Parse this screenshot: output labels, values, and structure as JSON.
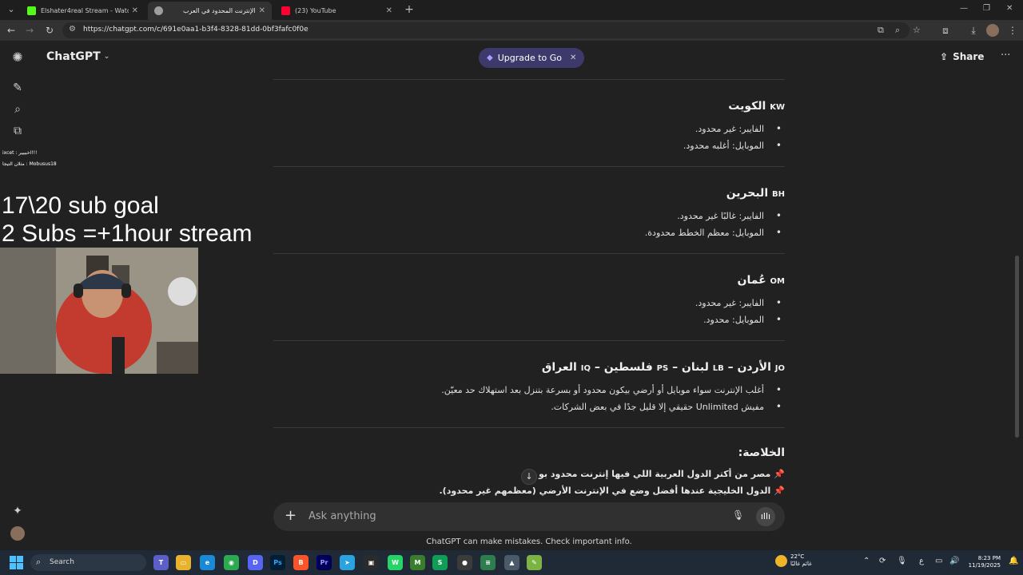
{
  "browser": {
    "tabs": [
      {
        "title": "Elshater4real Stream - Watch Li",
        "favicon_color": "#53fc18",
        "active": false
      },
      {
        "title": "الإنترنت المحدود في العرب",
        "favicon_color": "#9e9e9e",
        "active": true
      },
      {
        "title": "(23) YouTube",
        "favicon_color": "#ff0033",
        "active": false
      }
    ],
    "new_tab_icon": "plus-icon",
    "url": "https://chatgpt.com/c/691e0aa1-b3f4-8328-81dd-0bf3fafc0f0e"
  },
  "app": {
    "model_name": "ChatGPT",
    "upgrade_label": "Upgrade to Go",
    "share_label": "Share",
    "accent_color": "#3d3a6b"
  },
  "overlay": {
    "chat_line_1": "ixcet : اخبييير!!!",
    "chat_line_2": "مثلان التيجا : Mobusus18",
    "goal_line_1": "17\\20 sub goal",
    "goal_line_2": "2 Subs =+1hour stream"
  },
  "sections": [
    {
      "title": "الكويت",
      "code": "KW",
      "items": [
        "الفايبر: غير محدود.",
        "الموبايل: أغلبه محدود."
      ]
    },
    {
      "title": "البحرين",
      "code": "BH",
      "items": [
        "الفايبر: غالبًا غير محدود.",
        "الموبايل: معظم الخطط محدودة."
      ]
    },
    {
      "title": "عُمان",
      "code": "OM",
      "items": [
        "الفايبر: غير محدود.",
        "الموبايل: محدود."
      ]
    },
    {
      "title_parts": [
        "الأردن –",
        "لبنان –",
        "فلسطين –",
        "العراق"
      ],
      "codes": [
        "JO",
        "LB",
        "PS",
        "IQ"
      ],
      "items": [
        "أغلب الإنترنت سواء موبايل أو أرضي بيكون محدود أو بسرعة بتنزل بعد استهلاك حد معيّن.",
        "مفيش Unlimited حقيقي إلا قليل جدًا في بعض الشركات."
      ]
    }
  ],
  "summary": {
    "title": "الخلاصة:",
    "lines": [
      "مصر من أكتر الدول العربية اللي فيها إنترنت محدود بو ح.",
      "الدول الخليجية عندها أفضل وضع في الإنترنت الأرضي (معظمهم غير محدود)."
    ]
  },
  "composer": {
    "placeholder": "Ask anything"
  },
  "disclaimer": "ChatGPT can make mistakes. Check important info.",
  "taskbar": {
    "search_label": "Search",
    "weather_temp": "22°C",
    "weather_desc": "غائم غالبًا",
    "time": "8:23 PM",
    "date": "11/19/2025",
    "language": "ع"
  }
}
